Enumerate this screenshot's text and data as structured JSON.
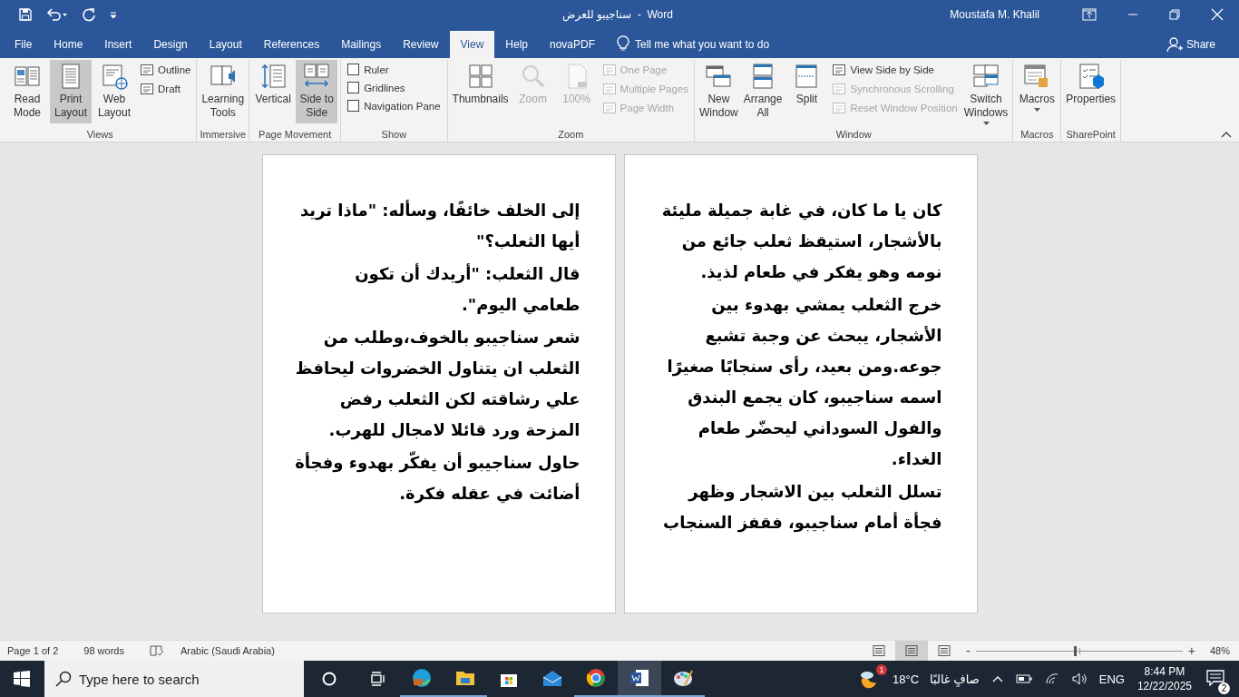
{
  "title_bar": {
    "title": "سناجيبو للعرض  -  Word",
    "user": "Moustafa M. Khalil"
  },
  "tabs": [
    {
      "label": "File",
      "selected": false
    },
    {
      "label": "Home",
      "selected": false
    },
    {
      "label": "Insert",
      "selected": false
    },
    {
      "label": "Design",
      "selected": false
    },
    {
      "label": "Layout",
      "selected": false
    },
    {
      "label": "References",
      "selected": false
    },
    {
      "label": "Mailings",
      "selected": false
    },
    {
      "label": "Review",
      "selected": false
    },
    {
      "label": "View",
      "selected": true
    },
    {
      "label": "Help",
      "selected": false
    },
    {
      "label": "novaPDF",
      "selected": false
    }
  ],
  "tell_me": {
    "placeholder": "Tell me what you want to do"
  },
  "share": {
    "label": "Share"
  },
  "ribbon": {
    "groups": [
      {
        "label": "Views",
        "items": [
          {
            "kind": "large",
            "label": "Read Mode",
            "selected": false,
            "disabled": false
          },
          {
            "kind": "large",
            "label": "Print Layout",
            "selected": true,
            "disabled": false
          },
          {
            "kind": "large",
            "label": "Web Layout",
            "selected": false,
            "disabled": false
          },
          {
            "kind": "stack",
            "items": [
              {
                "kind": "small",
                "label": "Outline",
                "disabled": false
              },
              {
                "kind": "small",
                "label": "Draft",
                "disabled": false
              }
            ]
          }
        ]
      },
      {
        "label": "Immersive",
        "items": [
          {
            "kind": "large",
            "label": "Learning Tools",
            "selected": false,
            "disabled": false
          }
        ]
      },
      {
        "label": "Page Movement",
        "items": [
          {
            "kind": "large",
            "label": "Vertical",
            "selected": false,
            "disabled": false
          },
          {
            "kind": "large",
            "label": "Side to Side",
            "selected": true,
            "disabled": false
          }
        ]
      },
      {
        "label": "Show",
        "items": [
          {
            "kind": "stack",
            "items": [
              {
                "kind": "checkbox",
                "label": "Ruler",
                "checked": false
              },
              {
                "kind": "checkbox",
                "label": "Gridlines",
                "checked": false
              },
              {
                "kind": "checkbox",
                "label": "Navigation Pane",
                "checked": false
              }
            ]
          }
        ]
      },
      {
        "label": "Zoom",
        "items": [
          {
            "kind": "large",
            "label": "Thumbnails",
            "selected": false,
            "disabled": false
          },
          {
            "kind": "large",
            "label": "Zoom",
            "selected": false,
            "disabled": true
          },
          {
            "kind": "large",
            "label": "100%",
            "selected": false,
            "disabled": true
          },
          {
            "kind": "stack",
            "items": [
              {
                "kind": "small",
                "label": "One Page",
                "disabled": true
              },
              {
                "kind": "small",
                "label": "Multiple Pages",
                "disabled": true
              },
              {
                "kind": "small",
                "label": "Page Width",
                "disabled": true
              }
            ]
          }
        ]
      },
      {
        "label": "Window",
        "items": [
          {
            "kind": "large",
            "label": "New Window",
            "selected": false,
            "disabled": false
          },
          {
            "kind": "large",
            "label": "Arrange All",
            "selected": false,
            "disabled": false
          },
          {
            "kind": "large",
            "label": "Split",
            "selected": false,
            "disabled": false
          },
          {
            "kind": "stack",
            "items": [
              {
                "kind": "small",
                "label": "View Side by Side",
                "disabled": false
              },
              {
                "kind": "small",
                "label": "Synchronous Scrolling",
                "disabled": true
              },
              {
                "kind": "small",
                "label": "Reset Window Position",
                "disabled": true
              }
            ]
          },
          {
            "kind": "large",
            "label": "Switch Windows",
            "selected": false,
            "disabled": false,
            "dropdown": true
          }
        ]
      },
      {
        "label": "Macros",
        "items": [
          {
            "kind": "large",
            "label": "Macros",
            "selected": false,
            "disabled": false,
            "dropdown": true
          }
        ]
      },
      {
        "label": "SharePoint",
        "items": [
          {
            "kind": "large",
            "label": "Properties",
            "selected": false,
            "disabled": false
          }
        ]
      }
    ]
  },
  "pages": [
    {
      "paragraphs": [
        "كان يا ما كان، في غابة جميلة مليئة بالأشجار، استيقظ ثعلب جائع من نومه وهو يفكر في طعام لذيذ.",
        "خرج الثعلب يمشي بهدوء بين الأشجار، يبحث عن وجبة تشبع جوعه.ومن بعيد، رأى سنجابًا صغيرًا اسمه سناجيبو، كان يجمع البندق والفول السوداني ليحضّر طعام الغداء.",
        "تسلل الثعلب بين الاشجار وظهر فجأة أمام سناجيبو، فقفز السنجاب"
      ]
    },
    {
      "paragraphs": [
        "إلى الخلف خائفًا، وسأله: \"ماذا تريد أيها الثعلب؟\"",
        "قال الثعلب: \"أريدك أن تكون طعامي اليوم\".",
        "شعر سناجيبو بالخوف،وطلب من الثعلب ان يتناول الخضروات ليحافظ علي رشاقته لكن الثعلب رفض المزحة ورد قائلا لامجال للهرب.",
        "حاول سناجيبو أن يفكّر بهدوء وفجأة أضائت في عقله فكرة."
      ]
    }
  ],
  "status_bar": {
    "page": "Page 1 of 2",
    "words": "98 words",
    "language": "Arabic (Saudi Arabia)",
    "views": [
      {
        "selected": false
      },
      {
        "selected": true
      },
      {
        "selected": false
      }
    ],
    "zoom_out": "-",
    "zoom_in": "+",
    "zoom": {
      "level": 0.48
    },
    "zoom_reading": "48%"
  },
  "taskbar": {
    "search": {
      "placeholder": "Type here to search"
    },
    "apps": [
      {
        "running": true,
        "selected": false
      },
      {
        "running": true,
        "selected": false
      },
      {
        "running": false,
        "selected": false
      },
      {
        "running": false,
        "selected": false
      },
      {
        "running": true,
        "selected": false
      },
      {
        "running": true,
        "selected": true
      },
      {
        "running": true,
        "selected": false
      }
    ],
    "weather": {
      "badge": "1",
      "temperature": "18°C",
      "condition": "صافٍ غالبًا"
    },
    "language": "ENG",
    "time": "8:44 PM",
    "date": "12/22/2025",
    "notifications": "2"
  }
}
